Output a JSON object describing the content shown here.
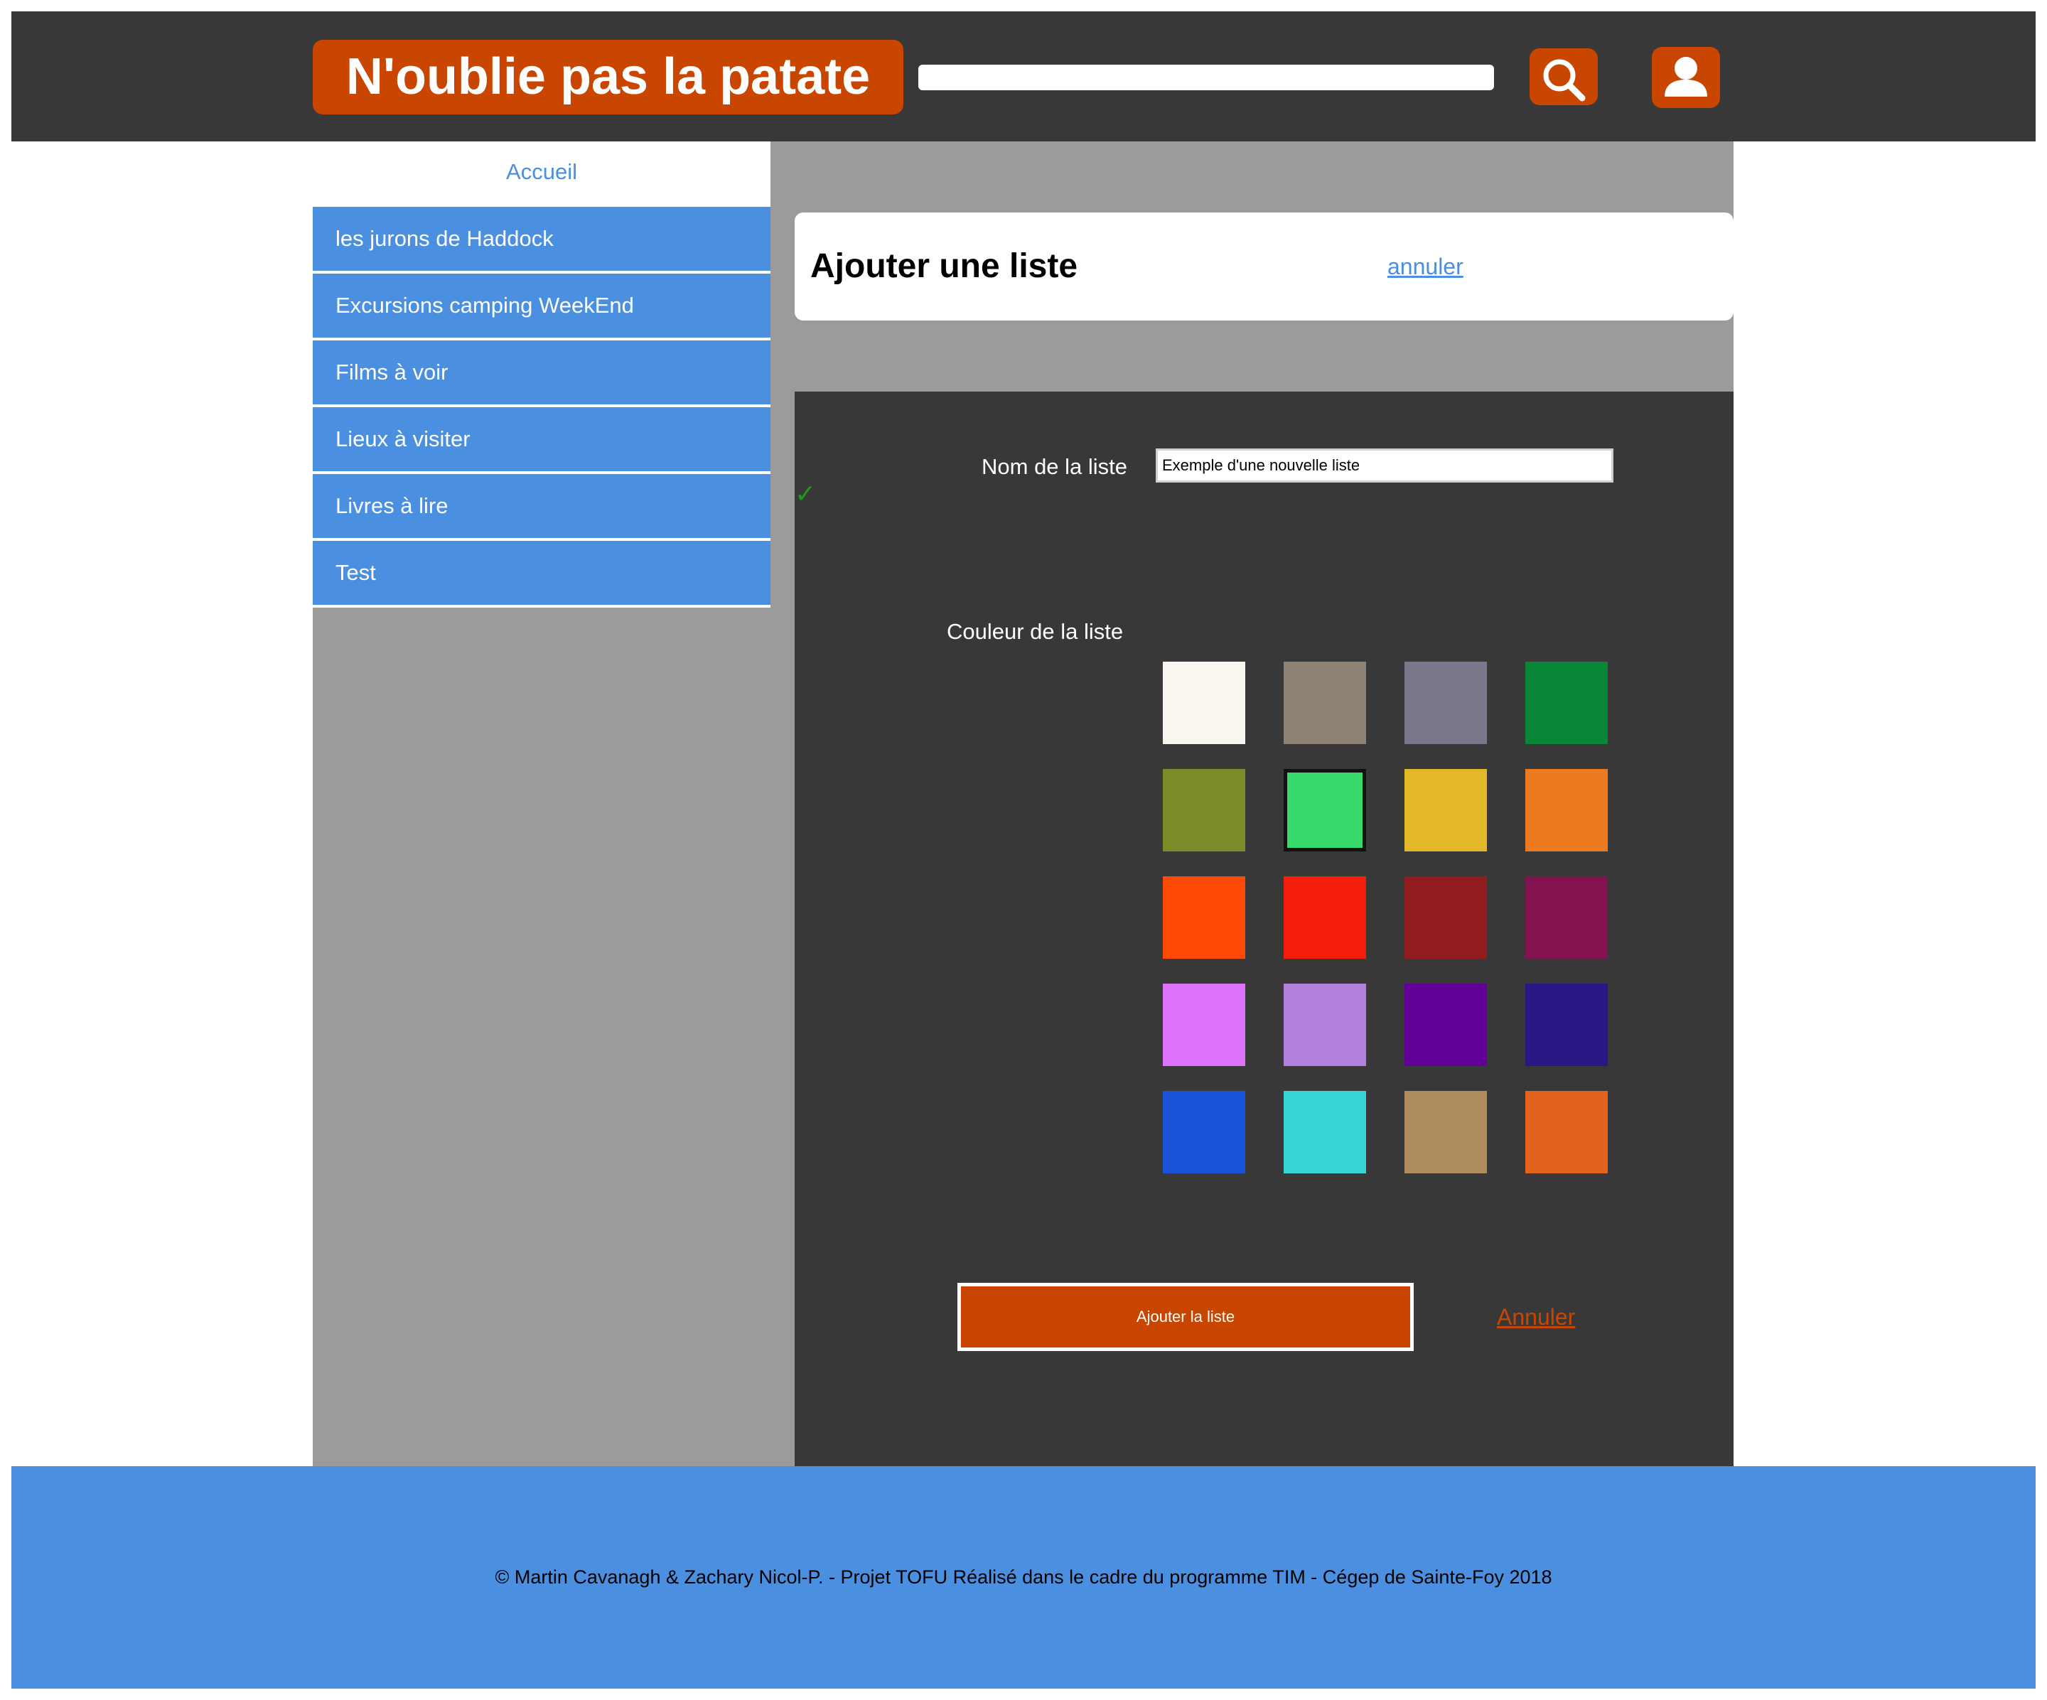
{
  "header": {
    "logo": "N'oublie pas la patate",
    "search_value": "",
    "search_icon": "search-icon",
    "user_icon": "user-icon",
    "accent_color": "#c84600"
  },
  "sidebar": {
    "home_link": "Accueil",
    "items": [
      {
        "label": "les jurons de Haddock"
      },
      {
        "label": "Excursions camping WeekEnd"
      },
      {
        "label": "Films à voir"
      },
      {
        "label": "Lieux à visiter"
      },
      {
        "label": "Livres à lire"
      },
      {
        "label": "Test"
      }
    ],
    "item_color": "#4a8fe0"
  },
  "main": {
    "title": "Ajouter une liste",
    "cancel_link": "annuler",
    "form": {
      "name_label": "Nom de la liste",
      "name_value": "Exemple d'une nouvelle liste",
      "valid_mark": "✓",
      "color_label": "Couleur de la liste",
      "colors": [
        "#f9f6ef",
        "#8e8176",
        "#7b778a",
        "#0a8637",
        "#7b8b27",
        "#36d96a",
        "#e3b92a",
        "#ec7a1e",
        "#fe4a04",
        "#f41d0c",
        "#931c1e",
        "#83134f",
        "#dd73fb",
        "#b280dc",
        "#620097",
        "#271885",
        "#1853d8",
        "#38d5d7",
        "#ad8b5c",
        "#e1631d"
      ],
      "selected_color": "#36d96a",
      "submit_label": "Ajouter la liste",
      "cancel_label": "Annuler"
    }
  },
  "footer": {
    "text": "© Martin Cavanagh & Zachary Nicol-P. - Projet TOFU Réalisé dans le cadre du programme TIM - Cégep de Sainte-Foy 2018"
  }
}
